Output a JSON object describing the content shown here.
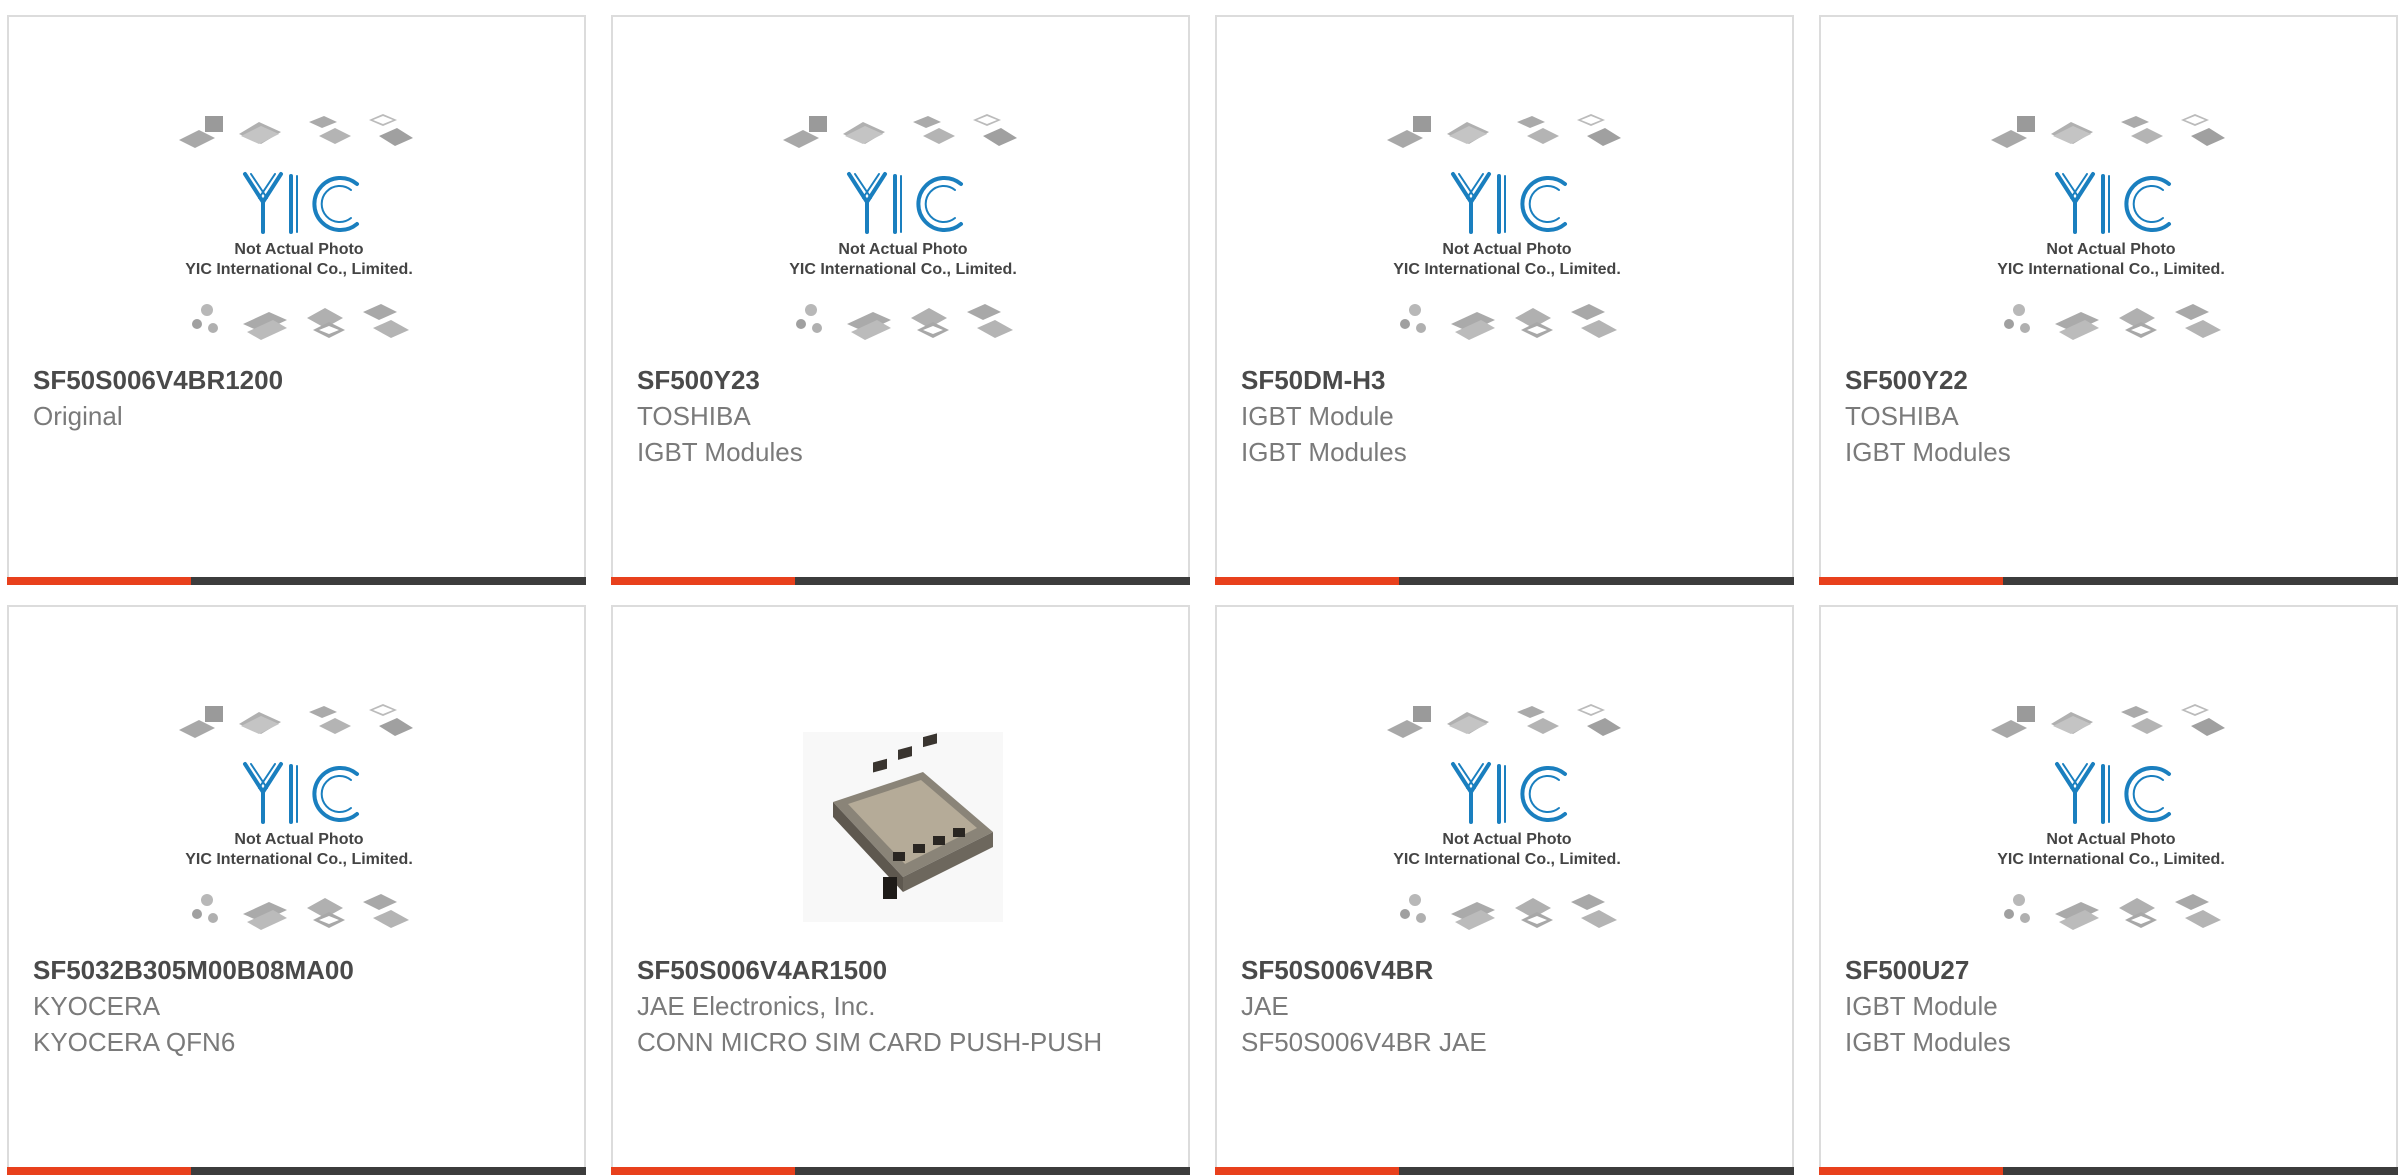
{
  "placeholder": {
    "line1": "Not Actual Photo",
    "line2": "YIC International Co., Limited."
  },
  "products": [
    {
      "part": "SF50S006V4BR1200",
      "line1": "Original",
      "line2": ""
    },
    {
      "part": "SF500Y23",
      "line1": "TOSHIBA",
      "line2": "IGBT Modules"
    },
    {
      "part": "SF50DM-H3",
      "line1": "IGBT Module",
      "line2": "IGBT Modules"
    },
    {
      "part": "SF500Y22",
      "line1": "TOSHIBA",
      "line2": "IGBT Modules"
    },
    {
      "part": "SF5032B305M00B08MA00",
      "line1": "KYOCERA",
      "line2": "KYOCERA QFN6"
    },
    {
      "part": "SF50S006V4AR1500",
      "line1": "JAE Electronics, Inc.",
      "line2": "CONN MICRO SIM CARD PUSH-PUSH"
    },
    {
      "part": "SF50S006V4BR",
      "line1": "JAE",
      "line2": "SF50S006V4BR JAE"
    },
    {
      "part": "SF500U27",
      "line1": "IGBT Module",
      "line2": "IGBT Modules"
    }
  ],
  "colors": {
    "accent": "#e8401c",
    "bar": "#3c3c3c",
    "logo": "#1a7fbf"
  },
  "icons": {
    "placeholder": "yic-placeholder-image",
    "product_photo": "sim-card-connector-photo"
  }
}
